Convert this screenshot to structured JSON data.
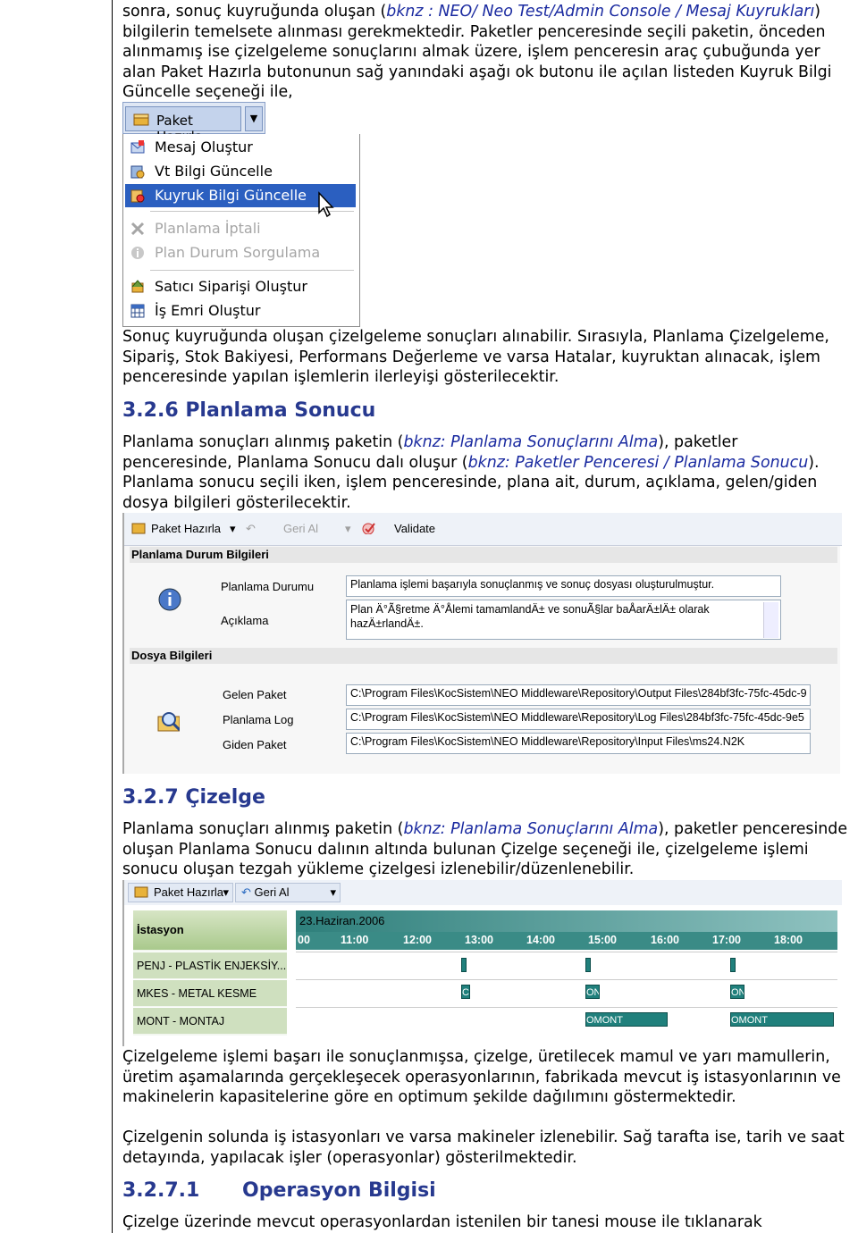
{
  "p1": {
    "a": "sonra, sonuç kuyruğunda oluşan (",
    "ref1": "bknz : NEO/ Neo Test/Admin Console / Mesaj Kuyrukları",
    "b": ") bilgilerin temelsete alınması gerekmektedir. Paketler penceresinde seçili paketin, önceden alınmamış ise çizelgeleme sonuçlarını almak üzere, işlem penceresin araç çubuğunda yer alan Paket Hazırla butonunun sağ yanındaki aşağı ok butonu ile açılan listeden Kuyruk Bilgi Güncelle seçeneği ile,"
  },
  "menu": {
    "button_label": "Paket Hazırla",
    "items": [
      {
        "label": "Mesaj Oluştur",
        "icon": "message-icon"
      },
      {
        "label": "Vt Bilgi Güncelle",
        "icon": "db-update-icon"
      },
      {
        "label": "Kuyruk Bilgi Güncelle",
        "icon": "queue-update-icon"
      },
      {
        "label": "Planlama İptali",
        "icon": "cancel-x-icon"
      },
      {
        "label": "Plan Durum Sorgulama",
        "icon": "info-icon"
      },
      {
        "label": "Satıcı Siparişi Oluştur",
        "icon": "order-icon"
      },
      {
        "label": "İş Emri Oluştur",
        "icon": "grid-icon"
      }
    ]
  },
  "p2": "Sonuç kuyruğunda oluşan çizelgeleme sonuçları alınabilir. Sırasıyla, Planlama Çizelgeleme, Sipariş, Stok Bakiyesi, Performans Değerleme ve varsa Hatalar, kuyruktan alınacak, işlem penceresinde yapılan işlemlerin ilerleyişi gösterilecektir.",
  "h1": {
    "num": "3.2.6",
    "title": "Planlama Sonucu"
  },
  "p3": {
    "a": "Planlama sonuçları alınmış paketin (",
    "ref1": "bknz: Planlama Sonuçlarını Alma",
    "b": "), paketler penceresinde, Planlama Sonucu dalı oluşur (",
    "ref2": "bknz: Paketler Penceresi / Planlama Sonucu",
    "c": "). Planlama sonucu seçili iken, işlem penceresinde, plana ait, durum, açıklama, gelen/giden dosya bilgileri gösterilecektir."
  },
  "result": {
    "toolbar": {
      "paket": "Paket Hazırla",
      "geri": "Geri Al",
      "validate": "Validate"
    },
    "durum_header": "Planlama Durum Bilgileri",
    "durum_label": "Planlama Durumu",
    "durum_value": "Planlama işlemi başarıyla sonuçlanmış ve sonuç dosyası oluşturulmuştur.",
    "aciklama_label": "Açıklama",
    "aciklama_value": "Plan Ä°Ã§retme Ä°Ålemi tamamlandÄ± ve sonuÃ§lar baÅarÄ±lÄ± olarak hazÄ±rlandÄ±.",
    "dosya_header": "Dosya Bilgileri",
    "gelen_label": "Gelen Paket",
    "gelen_value": "C:\\Program Files\\KocSistem\\NEO Middleware\\Repository\\Output Files\\284bf3fc-75fc-45dc-9",
    "log_label": "Planlama Log",
    "log_value": "C:\\Program Files\\KocSistem\\NEO Middleware\\Repository\\Log Files\\284bf3fc-75fc-45dc-9e5",
    "giden_label": "Giden Paket",
    "giden_value": "C:\\Program Files\\KocSistem\\NEO Middleware\\Repository\\Input Files\\ms24.N2K"
  },
  "h2": {
    "num": "3.2.7",
    "title": "Çizelge"
  },
  "p4": {
    "a": "Planlama sonuçları alınmış paketin (",
    "ref1": "bknz: Planlama Sonuçlarını Alma",
    "b": "), paketler penceresinde oluşan Planlama Sonucu dalının altında bulunan Çizelge seçeneği ile, çizelgeleme işlemi sonucu oluşan tezgah yükleme çizelgesi izlenebilir/düzenlenebilir."
  },
  "gantt": {
    "toolbar": {
      "paket": "Paket Hazırla",
      "geri": "Geri Al"
    },
    "station_header": "İstasyon",
    "date": "23.Haziran.2006",
    "times": [
      "00",
      "11:00",
      "12:00",
      "13:00",
      "14:00",
      "15:00",
      "16:00",
      "17:00",
      "18:00"
    ],
    "rows": [
      "PENJ - PLASTİK ENJEKSİY...",
      "MKES - METAL KESME",
      "MONT - MONTAJ"
    ],
    "bar_labels": {
      "c": "C",
      "on": "ON",
      "omont": "OMONT"
    }
  },
  "p5": "Çizelgeleme işlemi başarı ile sonuçlanmışsa, çizelge, üretilecek mamul ve yarı mamullerin, üretim aşamalarında gerçekleşecek operasyonlarının, fabrikada mevcut iş istasyonlarının ve makinelerin kapasitelerine göre en optimum şekilde dağılımını göstermektedir.",
  "p6": "Çizelgenin solunda iş istasyonları ve varsa makineler izlenebilir. Sağ tarafta ise, tarih ve saat detayında, yapılacak işler (operasyonlar) gösterilmektedir.",
  "h3": {
    "num": "3.2.7.1",
    "title": "Operasyon Bilgisi"
  },
  "p7": "Çizelge üzerinde mevcut operasyonlardan istenilen bir tanesi mouse ile tıklanarak",
  "colors": {
    "heading": "#27398f",
    "ref": "#1a2aa0",
    "menu_selected": "#2b5fc0",
    "gantt_bar": "#20807c"
  }
}
